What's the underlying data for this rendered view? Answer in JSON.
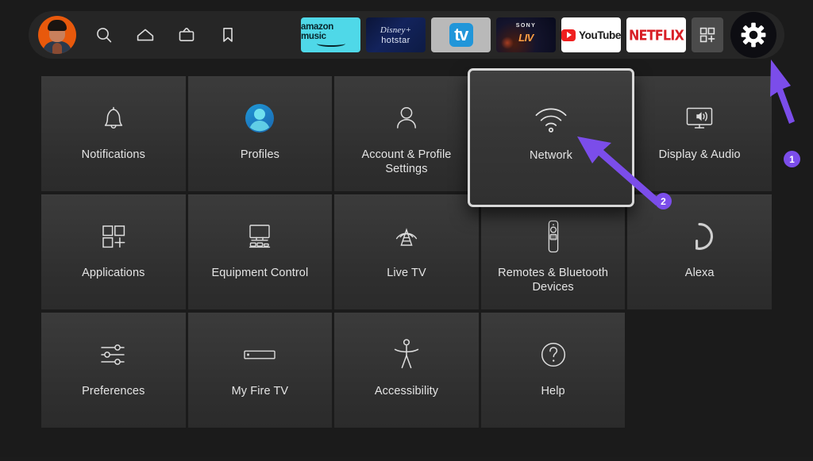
{
  "app": {
    "name": "Fire TV Settings",
    "background_color": "#1b1b1b",
    "accent_color": "#7b4dea"
  },
  "topbar": {
    "avatar": {
      "name": "user-avatar",
      "background_color": "#e8590c"
    },
    "nav_icons": [
      {
        "icon": "search-icon",
        "label": "Search"
      },
      {
        "icon": "home-icon",
        "label": "Home"
      },
      {
        "icon": "live-tv-icon",
        "label": "Live"
      },
      {
        "icon": "bookmark-icon",
        "label": "Watchlist"
      }
    ],
    "apps": [
      {
        "id": "amazon-music",
        "label": "amazon music",
        "line1": "amazon music"
      },
      {
        "id": "disney-hotstar",
        "label": "Disney+ hotstar",
        "line1": "Disney+",
        "line2": "hotstar"
      },
      {
        "id": "apple-tv",
        "label": "tv",
        "line1": "tv"
      },
      {
        "id": "sony-liv",
        "label": "SONY LIV",
        "line1": "SONY",
        "line2": "LIV"
      },
      {
        "id": "youtube",
        "label": "YouTube",
        "line1": "YouTube"
      },
      {
        "id": "netflix",
        "label": "NETFLIX",
        "line1": "NETFLIX"
      },
      {
        "id": "app-library",
        "label": "Apps"
      }
    ],
    "settings_button": {
      "icon": "gear-icon",
      "label": "Settings",
      "selected": true
    }
  },
  "grid": {
    "tiles": [
      {
        "label": "Notifications",
        "icon": "bell-icon",
        "selected": false
      },
      {
        "label": "Profiles",
        "icon": "profile-avatar-icon",
        "selected": false
      },
      {
        "label": "Account & Profile Settings",
        "icon": "person-outline-icon",
        "selected": false
      },
      {
        "label": "Network",
        "icon": "wifi-icon",
        "selected": true
      },
      {
        "label": "Display & Audio",
        "icon": "display-audio-icon",
        "selected": false
      },
      {
        "label": "Applications",
        "icon": "applications-icon",
        "selected": false
      },
      {
        "label": "Equipment Control",
        "icon": "equipment-control-icon",
        "selected": false
      },
      {
        "label": "Live TV",
        "icon": "antenna-icon",
        "selected": false
      },
      {
        "label": "Remotes & Bluetooth Devices",
        "icon": "remote-icon",
        "selected": false
      },
      {
        "label": "Alexa",
        "icon": "alexa-icon",
        "selected": false
      },
      {
        "label": "Preferences",
        "icon": "sliders-icon",
        "selected": false
      },
      {
        "label": "My Fire TV",
        "icon": "fire-tv-stick-icon",
        "selected": false
      },
      {
        "label": "Accessibility",
        "icon": "accessibility-icon",
        "selected": false
      },
      {
        "label": "Help",
        "icon": "question-mark-icon",
        "selected": false
      }
    ]
  },
  "annotations": {
    "color": "#7b4dea",
    "markers": [
      {
        "number": "1",
        "points_to": "Settings gear button"
      },
      {
        "number": "2",
        "points_to": "Network tile"
      }
    ]
  }
}
